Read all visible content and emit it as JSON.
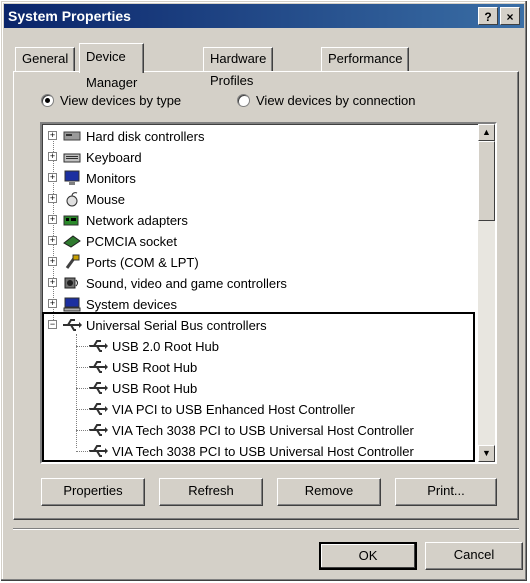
{
  "window": {
    "title": "System Properties",
    "help_button": "?",
    "close_button": "×"
  },
  "tabs": [
    "General",
    "Device Manager",
    "Hardware Profiles",
    "Performance"
  ],
  "view": {
    "by_type": "View devices by type",
    "by_connection": "View devices by connection"
  },
  "tree": [
    {
      "label": "Hard disk controllers",
      "icon": "disk-controller-icon"
    },
    {
      "label": "Keyboard",
      "icon": "keyboard-icon"
    },
    {
      "label": "Monitors",
      "icon": "monitor-icon"
    },
    {
      "label": "Mouse",
      "icon": "mouse-icon"
    },
    {
      "label": "Network adapters",
      "icon": "network-adapter-icon"
    },
    {
      "label": "PCMCIA socket",
      "icon": "pcmcia-icon"
    },
    {
      "label": "Ports (COM & LPT)",
      "icon": "port-icon"
    },
    {
      "label": "Sound, video and game controllers",
      "icon": "sound-icon"
    },
    {
      "label": "System devices",
      "icon": "system-devices-icon"
    },
    {
      "label": "Universal Serial Bus controllers",
      "icon": "usb-icon"
    }
  ],
  "usb_children": [
    "USB 2.0 Root Hub",
    "USB Root Hub",
    "USB Root Hub",
    "VIA PCI to USB Enhanced Host Controller",
    "VIA Tech 3038 PCI to USB Universal Host Controller",
    "VIA Tech 3038 PCI to USB Universal Host Controller"
  ],
  "buttons": {
    "properties": "Properties",
    "refresh": "Refresh",
    "remove": "Remove",
    "print": "Print...",
    "ok": "OK",
    "cancel": "Cancel"
  }
}
